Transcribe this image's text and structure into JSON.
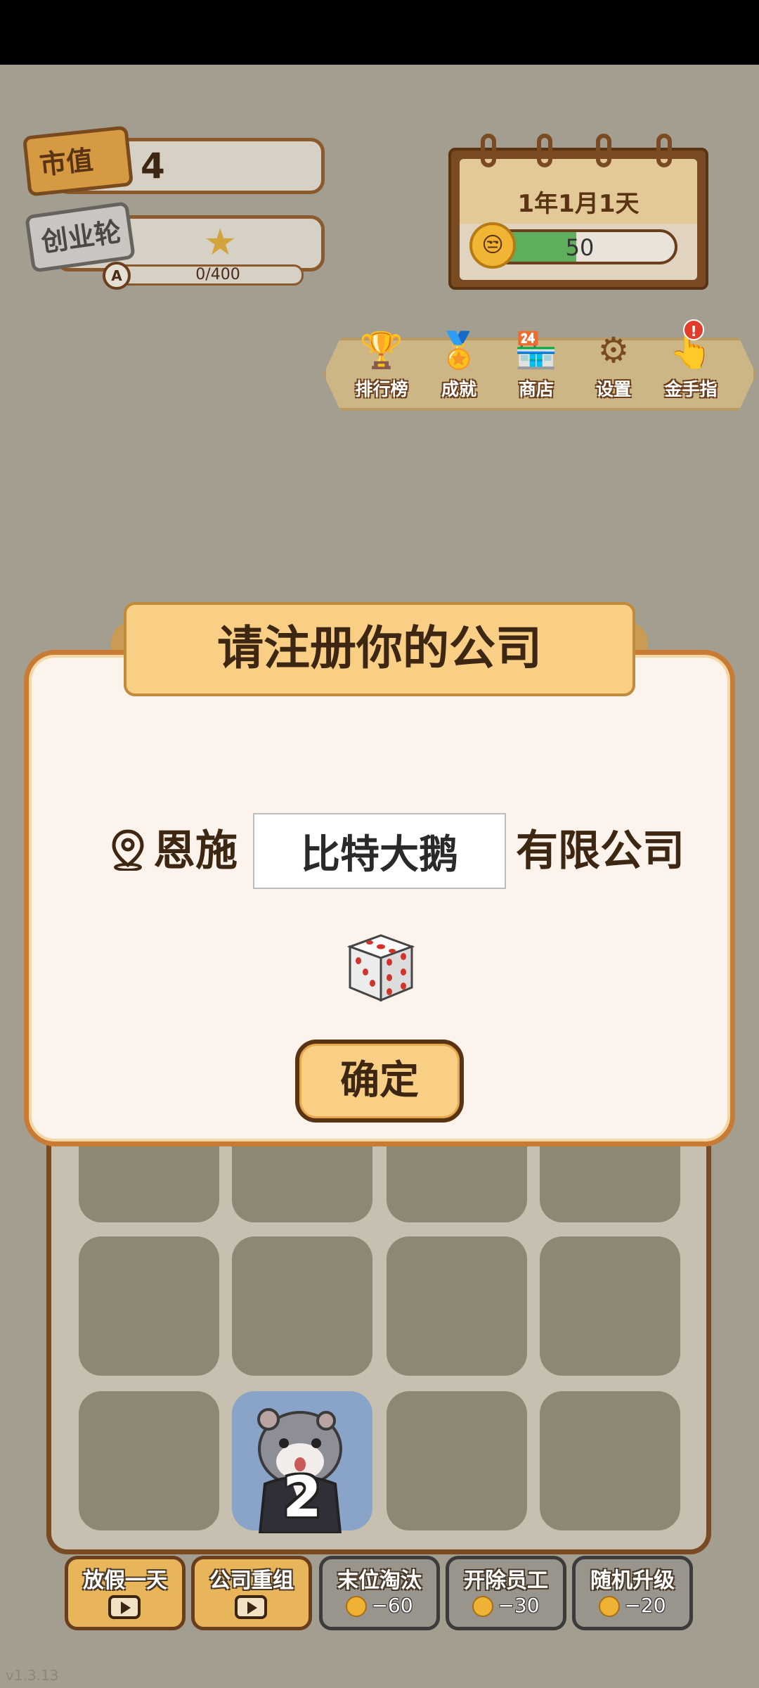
{
  "header": {
    "market_value_tag": "市值",
    "market_value": "4",
    "round_tag": "创业轮",
    "rank_badge": "A",
    "exp_progress": "0/400"
  },
  "calendar": {
    "date": "1年1月1天",
    "mood_value": "50",
    "mood_fraction": 0.5
  },
  "menu": [
    {
      "label": "排行榜",
      "icon": "trophy-icon"
    },
    {
      "label": "成就",
      "icon": "medal-icon"
    },
    {
      "label": "商店",
      "icon": "shop-icon"
    },
    {
      "label": "设置",
      "icon": "gear-icon"
    },
    {
      "label": "金手指",
      "icon": "hand-icon",
      "alert": "!"
    }
  ],
  "dialog": {
    "title": "请注册你的公司",
    "city": "恩施",
    "company_name": "比特大鹅",
    "suffix": "有限公司",
    "confirm": "确定"
  },
  "board": {
    "character_level": "2"
  },
  "actions": [
    {
      "label": "放假一天",
      "type": "ad"
    },
    {
      "label": "公司重组",
      "type": "ad"
    },
    {
      "label": "末位淘汰",
      "cost": "−60"
    },
    {
      "label": "开除员工",
      "cost": "−30"
    },
    {
      "label": "随机升级",
      "cost": "−20"
    }
  ],
  "version": "v1.3.13",
  "colors": {
    "background": "#a49e91",
    "dialog_border": "#c97b34",
    "title_bg": "#f9cf86",
    "mood_green": "#5fae5e"
  }
}
